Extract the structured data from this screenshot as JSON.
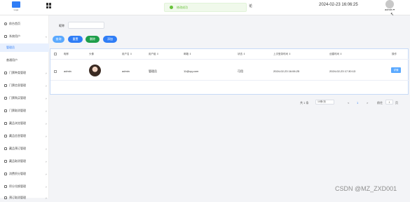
{
  "header": {
    "logo_caption": "Logo",
    "toast_message": "修改成功",
    "top_fragment": "论",
    "datetime": "2024-02-23 16:06:25",
    "user": "admin ▾"
  },
  "sidebar": {
    "items": [
      {
        "label": "前台首页"
      },
      {
        "label": "系统用户"
      },
      {
        "label": "管理员"
      },
      {
        "label": "普通用户"
      },
      {
        "label": "门票种类管理"
      },
      {
        "label": "门票信息管理"
      },
      {
        "label": "门票购买管理"
      },
      {
        "label": "门票取消管理"
      },
      {
        "label": "藏品浏览管理"
      },
      {
        "label": "藏品信息管理"
      },
      {
        "label": "藏品预订管理"
      },
      {
        "label": "藏品取消管理"
      },
      {
        "label": "消费积分管理"
      },
      {
        "label": "积分兑换管理"
      },
      {
        "label": "预订取消管理"
      }
    ]
  },
  "search": {
    "label": "昵称",
    "value": ""
  },
  "toolbar": {
    "query_label": "查询",
    "reset_label": "重置",
    "delete_label": "删除",
    "add_label": "添加"
  },
  "table": {
    "columns": [
      "昵称",
      "头像",
      "用户名 ⇕",
      "用户组 ⇕",
      "邮箱 ⇕",
      "状态 ⇕",
      "上次登录时间 ⇕",
      "创建时间 ⇕",
      "操作"
    ],
    "rows": [
      {
        "nickname": "admin",
        "username": "admin",
        "group": "管理员",
        "email": "11@qq.com",
        "status": "可用",
        "last_login": "2024-02-23 16:06:25",
        "created": "2024-02-23 17:30:13",
        "action": "详情"
      }
    ]
  },
  "pager": {
    "total": "共 1 条",
    "page_size": "10条/页",
    "prev": "<",
    "current": "1",
    "next": ">",
    "goto_label": "前往",
    "goto_value": "1",
    "page_unit": "页"
  },
  "watermark": "CSDN @MZ_ZXD001",
  "colors": {
    "primary": "#2f7df6",
    "query": "#5aa9ff",
    "reset": "#2f7df6",
    "delete": "#1e9e4a",
    "add": "#2f7df6"
  }
}
